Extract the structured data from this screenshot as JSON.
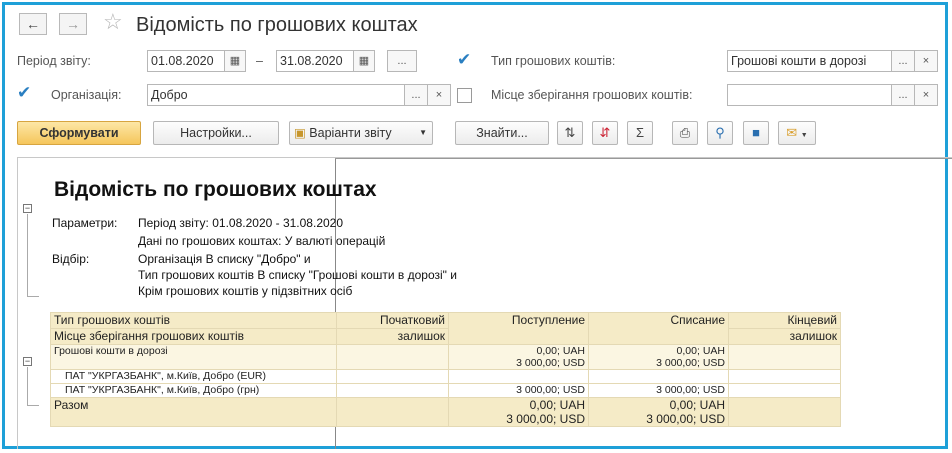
{
  "header": {
    "back_icon": "arrow-left-icon",
    "forward_icon": "arrow-right-icon",
    "favorite_icon": "star-icon",
    "title": "Відомість по грошових коштах"
  },
  "filters": {
    "period_label": "Період звіту:",
    "period_from": "01.08.2020",
    "period_dash": "–",
    "period_to": "31.08.2020",
    "select_btn": "...",
    "clear_btn": "×",
    "cash_type_label": "Тип грошових коштів:",
    "cash_type_value": "Грошові кошти в дорозі",
    "cash_type_checked": true,
    "org_label": "Організація:",
    "org_value": "Добро",
    "org_checked": true,
    "storage_label": "Місце зберігання грошових коштів:",
    "storage_value": "",
    "storage_checked": false
  },
  "toolbar": {
    "generate": "Сформувати",
    "settings": "Настройки...",
    "variants": "Варіанти звіту",
    "find": "Знайти...",
    "icons": [
      "sort-asc-icon",
      "sort-desc-icon",
      "sum-icon",
      "print-icon",
      "preview-icon",
      "save-icon",
      "email-icon"
    ]
  },
  "report": {
    "title": "Відомість по грошових коштах",
    "params_label": "Параметри:",
    "params_lines": [
      "Період звіту: 01.08.2020 - 31.08.2020",
      "Дані по грошових коштах: У валюті операцій"
    ],
    "filter_label": "Відбір:",
    "filter_lines": [
      "Організація В списку \"Добро\" и",
      "Тип грошових коштів В списку \"Грошові кошти в дорозі\" и",
      "Крім грошових коштів у підзвітних осіб"
    ],
    "columns": {
      "type": "Тип грошових коштів",
      "storage": "Місце зберігання грошових коштів",
      "opening_1": "Початковий",
      "opening_2": "залишок",
      "income": "Поступление",
      "outcome": "Списание",
      "closing_1": "Кінцевий",
      "closing_2": "залишок"
    },
    "group_row": {
      "name": "Грошові кошти в дорозі",
      "income_1": "0,00; UAH",
      "income_2": "3 000,00; USD",
      "outcome_1": "0,00; UAH",
      "outcome_2": "3 000,00; USD"
    },
    "detail_rows": [
      {
        "name": "ПАТ \"УКРГАЗБАНК\", м.Київ, Добро (EUR)",
        "income": "",
        "outcome": ""
      },
      {
        "name": "ПАТ \"УКРГАЗБАНК\", м.Київ, Добро (грн)",
        "income": "3 000,00; USD",
        "outcome": "3 000,00; USD"
      }
    ],
    "total_row": {
      "name": "Разом",
      "income_1": "0,00; UAH",
      "income_2": "3 000,00; USD",
      "outcome_1": "0,00; UAH",
      "outcome_2": "3 000,00; USD"
    }
  }
}
